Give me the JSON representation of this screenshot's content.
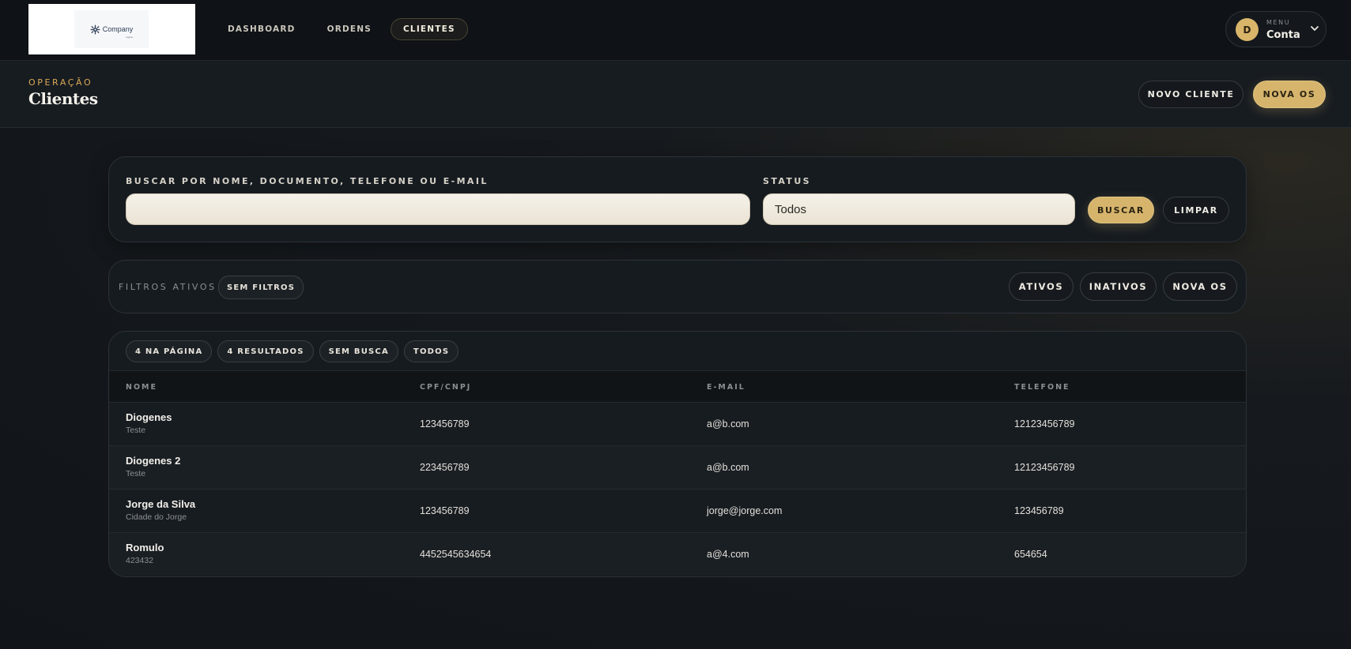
{
  "brand": {
    "logo_text": "Company",
    "logo_subtext": "tagline",
    "logo_color": "#2d3e55"
  },
  "nav": {
    "items": [
      {
        "label": "DASHBOARD",
        "active": false
      },
      {
        "label": "ORDENS",
        "active": false
      },
      {
        "label": "CLIENTES",
        "active": true
      }
    ]
  },
  "account": {
    "avatar_initial": "D",
    "menu_label": "MENU",
    "name": "Conta",
    "icon": "chevron-down-icon"
  },
  "header": {
    "eyebrow": "OPERAÇÃO",
    "title": "Clientes",
    "new_client_label": "NOVO CLIENTE",
    "new_os_label": "NOVA OS"
  },
  "search": {
    "query_label": "BUSCAR POR NOME, DOCUMENTO, TELEFONE OU E-MAIL",
    "query_value": "",
    "status_label": "STATUS",
    "status_value": "Todos",
    "search_button": "BUSCAR",
    "clear_button": "LIMPAR"
  },
  "filters": {
    "label": "FILTROS ATIVOS",
    "active_chip": "SEM FILTROS",
    "quick": [
      "ATIVOS",
      "INATIVOS",
      "NOVA OS"
    ]
  },
  "results": {
    "chips": [
      "4 NA PÁGINA",
      "4 RESULTADOS",
      "SEM BUSCA",
      "TODOS"
    ],
    "columns": [
      "NOME",
      "CPF/CNPJ",
      "E-MAIL",
      "TELEFONE"
    ],
    "rows": [
      {
        "name": "Diogenes",
        "sub": "Teste",
        "doc": "123456789",
        "email": "a@b.com",
        "phone": "12123456789"
      },
      {
        "name": "Diogenes 2",
        "sub": "Teste",
        "doc": "223456789",
        "email": "a@b.com",
        "phone": "12123456789"
      },
      {
        "name": "Jorge da Silva",
        "sub": "Cidade do Jorge",
        "doc": "123456789",
        "email": "jorge@jorge.com",
        "phone": "123456789"
      },
      {
        "name": "Romulo",
        "sub": "423432",
        "doc": "4452545634654",
        "email": "a@4.com",
        "phone": "654654"
      }
    ]
  },
  "colors": {
    "accent": "#d6b46c",
    "eyebrow": "#d9a955",
    "background": "#161b20"
  }
}
